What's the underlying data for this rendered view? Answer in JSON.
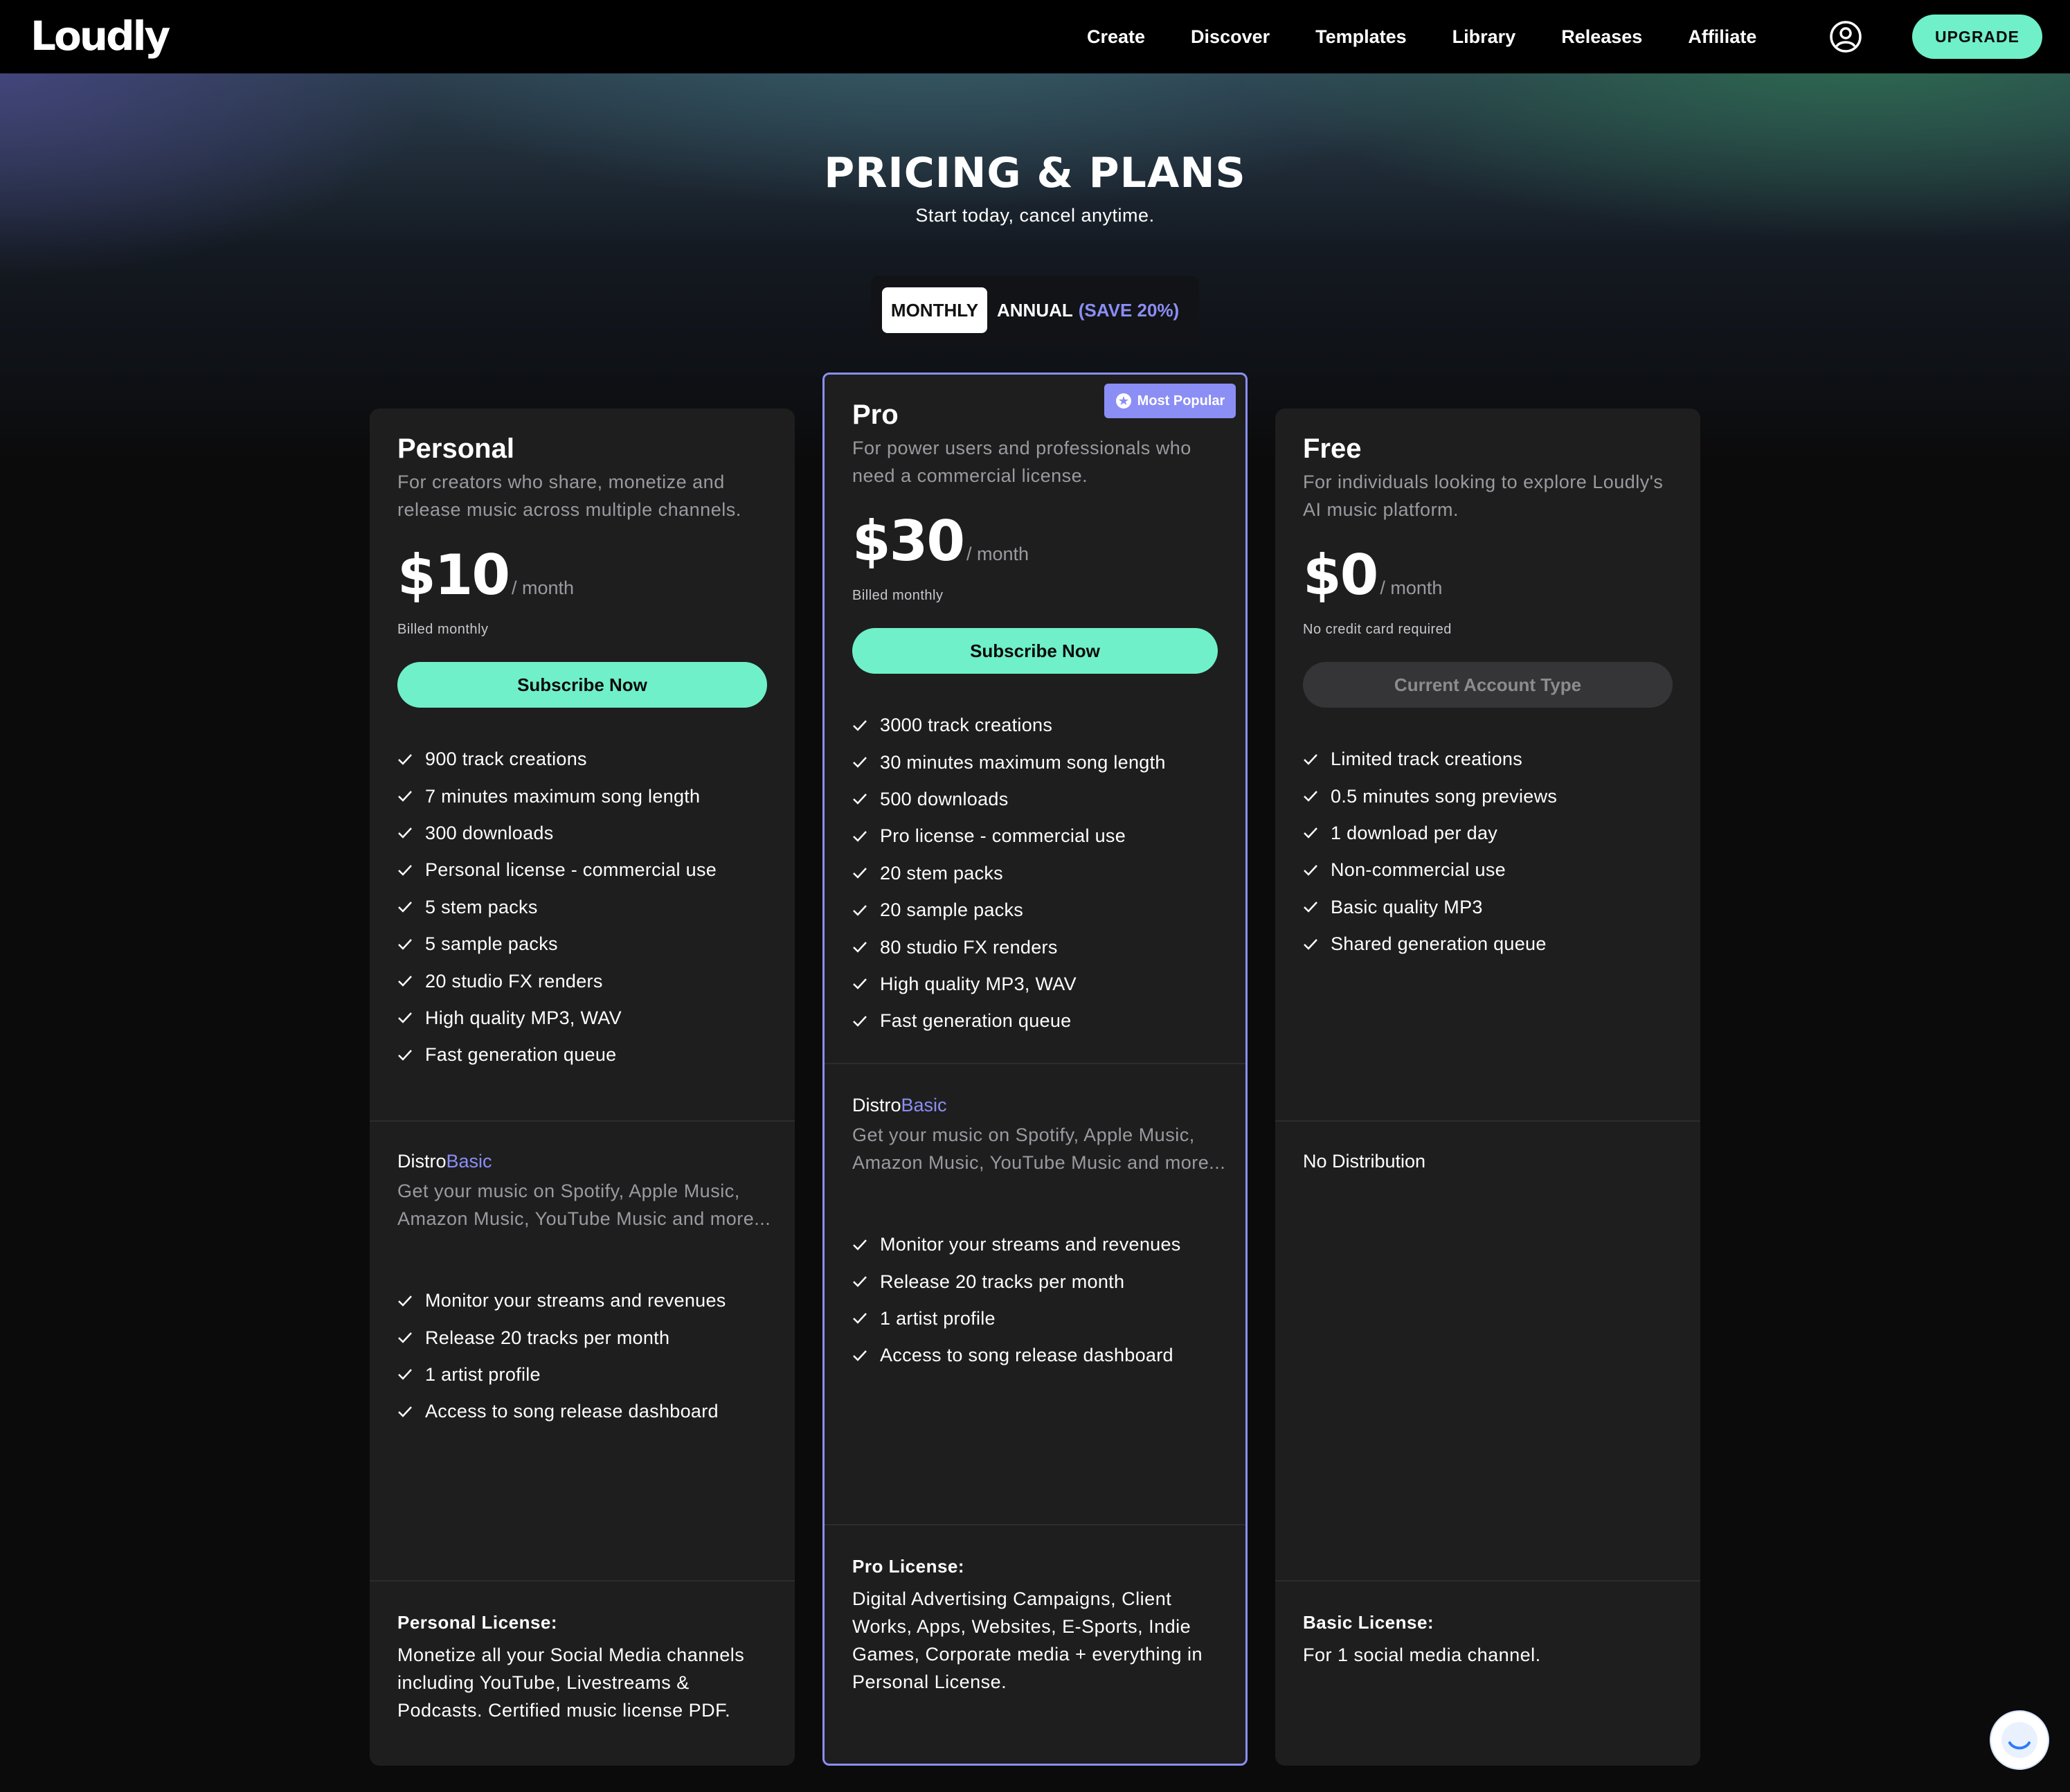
{
  "nav": {
    "logo": "Loudly",
    "links": [
      "Create",
      "Discover",
      "Templates",
      "Library",
      "Releases",
      "Affiliate"
    ],
    "upgrade_label": "UPGRADE",
    "profile_icon": "user-circle-icon"
  },
  "header": {
    "title": "PRICING & PLANS",
    "subtitle": "Start today, cancel anytime."
  },
  "billing_toggle": {
    "monthly_label": "MONTHLY",
    "annual_label": "ANNUAL",
    "annual_save": "(SAVE 20%)",
    "selected": "MONTHLY"
  },
  "plans": [
    {
      "name": "Personal",
      "description": "For creators who share, monetize and release music across multiple channels.",
      "price": "$10",
      "unit": "/ month",
      "billing_note": "Billed monthly",
      "cta_label": "Subscribe Now",
      "features": [
        "900 track creations",
        "7 minutes maximum song length",
        "300 downloads",
        "Personal license - commercial use",
        "5 stem packs",
        "5 sample packs",
        "20 studio FX renders",
        "High quality MP3, WAV",
        "Fast generation queue"
      ],
      "distro_prefix": "Distro",
      "distro_tier": "Basic",
      "distro_desc": "Get your music on Spotify, Apple Music, Amazon Music, YouTube Music and more...",
      "distro_features": [
        "Monitor your streams and revenues",
        "Release 20 tracks per month",
        "1 artist profile",
        "Access to song release dashboard"
      ],
      "license_title": "Personal License:",
      "license_desc": "Monetize all your Social Media channels including YouTube, Livestreams & Podcasts. Certified music license PDF."
    },
    {
      "name": "Pro",
      "badge": "Most Popular",
      "description": "For power users and professionals who need a commercial license.",
      "price": "$30",
      "unit": "/ month",
      "billing_note": "Billed monthly",
      "cta_label": "Subscribe Now",
      "features": [
        "3000 track creations",
        "30 minutes maximum song length",
        "500 downloads",
        "Pro license - commercial use",
        "20 stem packs",
        "20 sample packs",
        "80 studio FX renders",
        "High quality MP3, WAV",
        "Fast generation queue"
      ],
      "distro_prefix": "Distro",
      "distro_tier": "Basic",
      "distro_desc": "Get your music on Spotify, Apple Music, Amazon Music, YouTube Music and more...",
      "distro_features": [
        "Monitor your streams and revenues",
        "Release 20 tracks per month",
        "1 artist profile",
        "Access to song release dashboard"
      ],
      "license_title": "Pro License:",
      "license_desc": "Digital Advertising Campaigns, Client Works, Apps, Websites, E-Sports, Indie Games, Corporate media + everything in Personal License."
    },
    {
      "name": "Free",
      "description": "For individuals looking to explore Loudly's AI music platform.",
      "price": "$0",
      "unit": "/ month",
      "billing_note": "No credit card required",
      "cta_label": "Current Account Type",
      "features": [
        "Limited track creations",
        "0.5 minutes song previews",
        "1 download per day",
        "Non-commercial use",
        "Basic quality MP3",
        "Shared generation queue"
      ],
      "distro_none": "No Distribution",
      "license_title": "Basic License:",
      "license_desc": "For 1 social media channel."
    }
  ],
  "colors": {
    "accent_green": "#6ff0c8",
    "accent_purple": "#8b8ef5",
    "card_bg": "#1e1e1f",
    "page_bg": "#0b0b0c"
  }
}
